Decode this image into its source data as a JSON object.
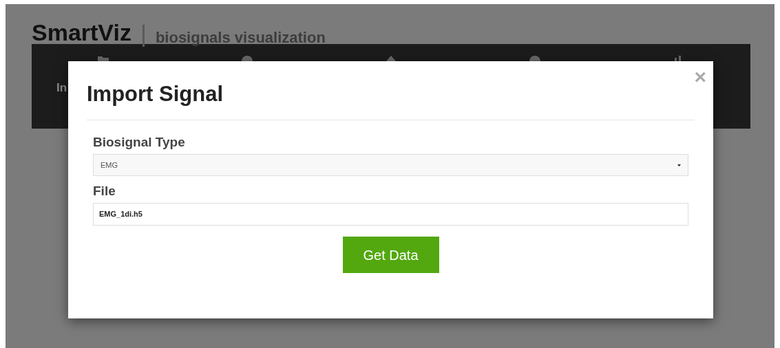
{
  "header": {
    "brand": "SmartViz",
    "tagline": "biosignals visualization"
  },
  "nav": {
    "items": [
      {
        "label": "In"
      }
    ]
  },
  "dialog": {
    "title": "Import Signal",
    "close": "×",
    "fields": [
      {
        "kind": "select",
        "label": "Biosignal Type",
        "value": "EMG"
      },
      {
        "kind": "text",
        "label": "File",
        "value": "EMG_1di.h5"
      }
    ],
    "button": "Get Data"
  }
}
